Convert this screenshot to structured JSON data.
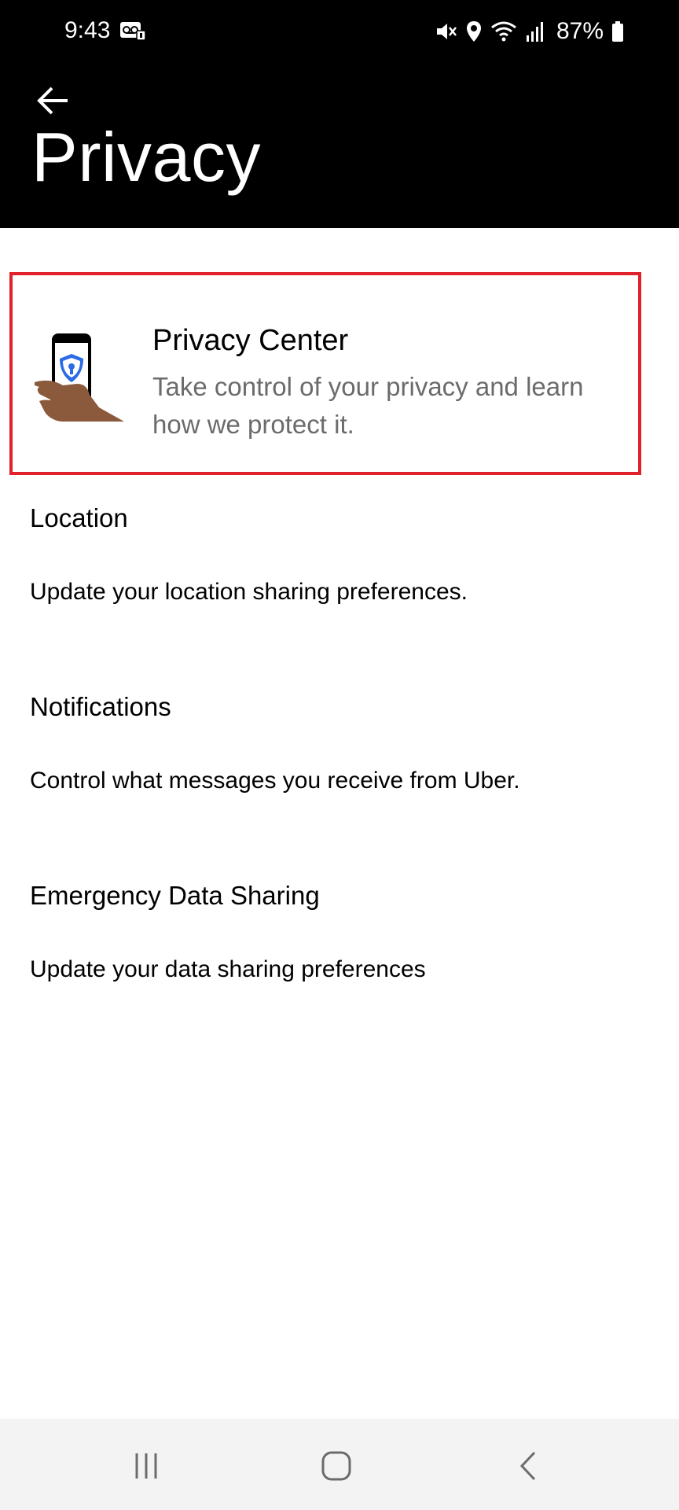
{
  "status_bar": {
    "time": "9:43",
    "battery": "87%",
    "icons": [
      "voicemail-icon",
      "mute-icon",
      "location-icon",
      "wifi-icon",
      "signal-icon",
      "battery-icon"
    ]
  },
  "header": {
    "title": "Privacy",
    "back_icon": "arrow-left-icon",
    "background": "#000000"
  },
  "privacy_center": {
    "title": "Privacy Center",
    "description": "Take control of your privacy and learn how we protect it.",
    "highlight_color": "#e0202b"
  },
  "settings": [
    {
      "title": "Location",
      "description": "Update your location sharing preferences."
    },
    {
      "title": "Notifications",
      "description": "Control what messages you receive from Uber."
    },
    {
      "title": "Emergency Data Sharing",
      "description": "Update your data sharing preferences"
    }
  ],
  "nav_bar": {
    "buttons": [
      "recent-apps-icon",
      "home-icon",
      "back-icon"
    ]
  }
}
